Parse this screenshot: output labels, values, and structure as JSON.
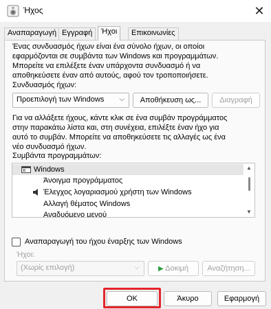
{
  "window": {
    "title": "Ήχος",
    "icon": "speaker-icon",
    "close_glyph": "✕"
  },
  "tabs": [
    {
      "label": "Αναπαραγωγή"
    },
    {
      "label": "Εγγραφή"
    },
    {
      "label": "Ήχοι"
    },
    {
      "label": "Επικοινωνίες"
    }
  ],
  "scheme": {
    "description": [
      "Ένας συνδυασμός ήχων είναι ένα σύνολο ήχων, οι οποίοι",
      "εφαρμόζονται σε συμβάντα των Windows και προγραμμάτων.",
      "Μπορείτε να επιλέξετε έναν υπάρχοντα συνδυασμό ή να",
      "αποθηκεύσετε έναν από αυτούς, αφού τον τροποποιήσετε."
    ],
    "label": "Συνδυασμός ήχων:",
    "selected": "Προεπιλογή των Windows",
    "save_button": "Αποθήκευση ως...",
    "delete_button": "Διαγραφή"
  },
  "events": {
    "description": [
      "Για να αλλάξετε ήχους, κάντε κλικ σε ένα συμβάν προγράμματος",
      "στην παρακάτω λίστα και, στη συνέχεια, επιλέξτε έναν ήχο για",
      "αυτό το συμβάν. Μπορείτε να αποθηκεύσετε τις αλλαγές ως ένα",
      "νέο συνδυασμό ήχων."
    ],
    "label": "Συμβάντα προγραμμάτων:",
    "group": "Windows",
    "items": [
      "Άνοιγμα προγράμματος",
      "Έλεγχος λογαριασμού χρήστη των Windows",
      "Αλλαγή θέματος Windows",
      "Αναδυόμενο μενού"
    ]
  },
  "startup": {
    "label": "Αναπαραγωγή του ήχου έναρξης των Windows",
    "checked": false
  },
  "sounds": {
    "label": "Ήχοι:",
    "selected": "(Χωρίς επιλογή)",
    "test_button": "Δοκιμή",
    "browse_button": "Αναζήτηση..."
  },
  "footer": {
    "ok": "OK",
    "cancel": "Άκυρο",
    "apply": "Εφαρμογή"
  },
  "colors": {
    "highlight": "#e3242b",
    "test_arrow": "#2e9e44"
  }
}
